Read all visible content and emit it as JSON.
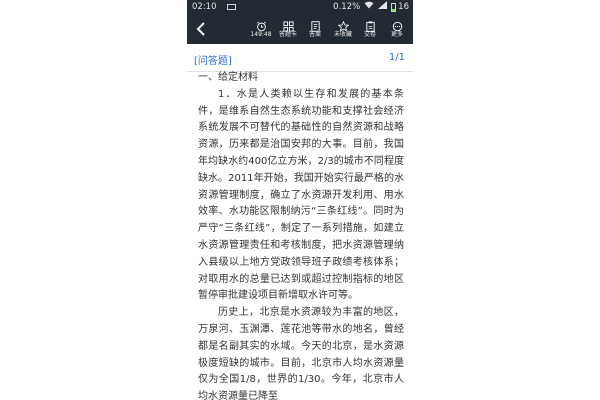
{
  "status_bar": {
    "time": "02:10",
    "network_speed": "0.12",
    "network_speed_unit": "%",
    "battery": "16"
  },
  "toolbar": {
    "items": [
      {
        "icon": "alarm-clock-icon",
        "label": "149:48"
      },
      {
        "icon": "grid-card-icon",
        "label": "答题卡"
      },
      {
        "icon": "answer-doc-icon",
        "label": "答案"
      },
      {
        "icon": "star-icon",
        "label": "未收藏"
      },
      {
        "icon": "submit-doc-icon",
        "label": "交卷"
      },
      {
        "icon": "more-dots-icon",
        "label": "更多"
      }
    ]
  },
  "question": {
    "type": "[问答题]",
    "page": "1/1"
  },
  "article": {
    "heading": "一、给定材料",
    "paragraphs": [
      "1．水是人类赖以生存和发展的基本条件，是维系自然生态系统功能和支撑社会经济系统发展不可替代的基础性的自然资源和战略资源，历来都是治国安邦的大事。目前，我国年均缺水约400亿立方米，2/3的城市不同程度缺水。2011年开始，我国开始实行最严格的水资源管理制度，确立了水资源开发利用、用水效率、水功能区限制纳污“三条红线”。同时为严守“三条红线”，制定了一系列措施，如建立水资源管理责任和考核制度，把水资源管理纳入县级以上地方党政领导班子政绩考核体系；对取用水的总量已达到或超过控制指标的地区暂停审批建设项目新增取水许可等。",
      "历史上，北京是水资源较为丰富的地区，万泉河、玉渊潭、莲花池等带水的地名，曾经都是名副其实的水域。今天的北京，是水资源极度短缺的城市。目前，北京市人均水资源量仅为全国1/8，世界的1/30。今年，北京市人均水资源量已降至"
    ]
  }
}
